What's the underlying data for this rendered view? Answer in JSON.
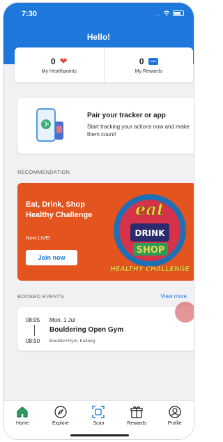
{
  "status": {
    "time": "7:30",
    "signal": "..."
  },
  "header": {
    "greeting": "Hello!"
  },
  "stats": {
    "healthpoints": {
      "value": "0",
      "label": "My Healthpoints"
    },
    "rewards": {
      "value": "0",
      "label": "My Rewards"
    }
  },
  "pair_card": {
    "title": "Pair your tracker or app",
    "description": "Start tracking your actions now and make them count!"
  },
  "recommendation": {
    "section_label": "RECOMMENDATION",
    "title": "Eat, Drink, Shop Healthy Challenge",
    "subtitle": "Now LIVE!",
    "button_label": "Join now",
    "badge_text": {
      "eat": "eat",
      "drink": "DRINK",
      "shop": "SHOP",
      "challenge": "HEALTHY CHALLENGE"
    }
  },
  "booked_events": {
    "section_label": "BOOKED EVENTS",
    "view_more_label": "View more",
    "event": {
      "start_time": "08:05",
      "end_time": "08:50",
      "date": "Mon, 1 Jul",
      "title": "Bouldering Open Gym",
      "location": "Boulder+Gym, Kallang"
    }
  },
  "bottom_nav": [
    {
      "label": "Home",
      "icon": "home-icon"
    },
    {
      "label": "Explore",
      "icon": "compass-icon"
    },
    {
      "label": "Scan",
      "icon": "scan-icon"
    },
    {
      "label": "Rewards",
      "icon": "gift-icon"
    },
    {
      "label": "Profile",
      "icon": "profile-icon"
    }
  ],
  "colors": {
    "primary": "#1e78dc",
    "promo": "#e4541f",
    "heart": "#e24a36",
    "home_active": "#1a7a4c"
  }
}
